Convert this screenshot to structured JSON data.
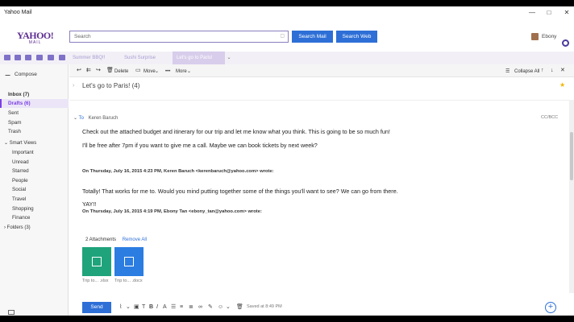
{
  "window": {
    "title": "Yahoo Mail",
    "controls": [
      "—",
      "□",
      "✕"
    ]
  },
  "header": {
    "logo_top": "YAHOO!",
    "logo_bottom": "MAIL",
    "search_placeholder": "Search",
    "search_mail_label": "Search Mail",
    "search_web_label": "Search Web",
    "user_name": "Ebony"
  },
  "tabs": [
    {
      "label": "Summer BBQ!!"
    },
    {
      "label": "Sushi Surprise"
    },
    {
      "label": "Let's go to Paris!"
    }
  ],
  "sidebar": {
    "compose": "Compose",
    "folders": [
      {
        "label": "Inbox (7)"
      },
      {
        "label": "Drafts (6)"
      },
      {
        "label": "Sent"
      },
      {
        "label": "Spam"
      },
      {
        "label": "Trash"
      }
    ],
    "smart_views_header": "Smart Views",
    "smart_views": [
      "Important",
      "Unread",
      "Starred",
      "People",
      "Social",
      "Travel",
      "Shopping",
      "Finance"
    ],
    "folders_label": "Folders (3)"
  },
  "toolbar": {
    "delete": "Delete",
    "move": "Move",
    "more": "More",
    "collapse_all": "Collapse All"
  },
  "message": {
    "subject": "Let's go to Paris!",
    "count": "(4)",
    "to_label": "To",
    "to_name": "Keren Baruch",
    "cc_bcc": "CC/BCC",
    "line1": "Check out the attached budget and itinerary for our trip and let me know what you think. This is going to be so much fun!",
    "line2": "I'll be free after 7pm if you want to give me a call. Maybe we can book tickets by next week?",
    "quote1_header": "On Thursday, July 16, 2015 4:23 PM, Keren Baruch <kerenbaruch@yahoo.com> wrote:",
    "quote1_body": "Totally! That works for me to. Would you mind putting together some of the things you'll want to see? We can go from there.",
    "quote2_top": "YAY!!",
    "quote2_header": "On Thursday, July 16, 2015 4:19 PM, Ebony Tan <ebony_tan@yahoo.com> wrote:"
  },
  "attachments": {
    "count_label": "2 Attachments",
    "remove_all": "Remove All",
    "items": [
      {
        "name": "Trip to... .xlsx",
        "type": "spreadsheet"
      },
      {
        "name": "Trip to... .docx",
        "type": "document"
      }
    ]
  },
  "compose_bar": {
    "send": "Send",
    "saved": "Saved at 8:49 PM"
  }
}
